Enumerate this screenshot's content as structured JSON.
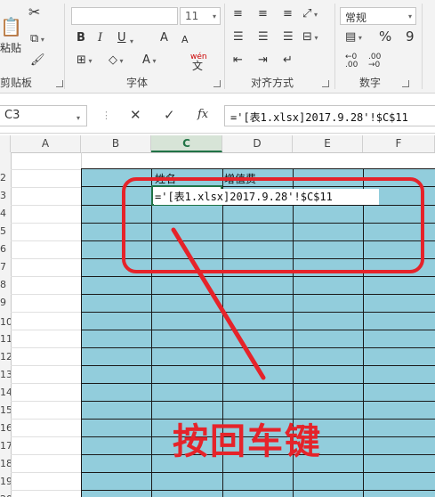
{
  "ribbon": {
    "clipboard": {
      "paste_label": "粘贴",
      "group_label": "剪贴板"
    },
    "font": {
      "font_name": "",
      "font_size": "11",
      "bold": "B",
      "italic": "I",
      "underline": "U",
      "grow": "A",
      "shrink": "A",
      "wen": "wén",
      "wen_char": "文",
      "group_label": "字体"
    },
    "alignment": {
      "group_label": "对齐方式"
    },
    "number": {
      "format": "常规",
      "percent": "%",
      "comma": "9",
      "group_label": "数字"
    }
  },
  "formula_bar": {
    "name_box": "C3",
    "cancel": "✕",
    "enter": "✓",
    "fx": "fx",
    "formula": "='[表1.xlsx]2017.9.28'!$C$11"
  },
  "sheet": {
    "columns": [
      "A",
      "B",
      "C",
      "D",
      "E",
      "F"
    ],
    "selected_column": "C",
    "rows": [
      "2",
      "3",
      "4",
      "5",
      "6",
      "7",
      "8",
      "9",
      "10",
      "11",
      "12",
      "13",
      "14",
      "15",
      "16",
      "17",
      "18",
      "19",
      "20"
    ],
    "header_cells": {
      "name": "姓名",
      "increment": "增值费"
    },
    "edit_value": "='[表1.xlsx]2017.9.28'!$C$11"
  },
  "annotation": {
    "text": "按回车键",
    "color": "#e5232a"
  },
  "colors": {
    "table_fill": "#92cddc",
    "accent": "#217346",
    "annotation": "#e5232a"
  }
}
